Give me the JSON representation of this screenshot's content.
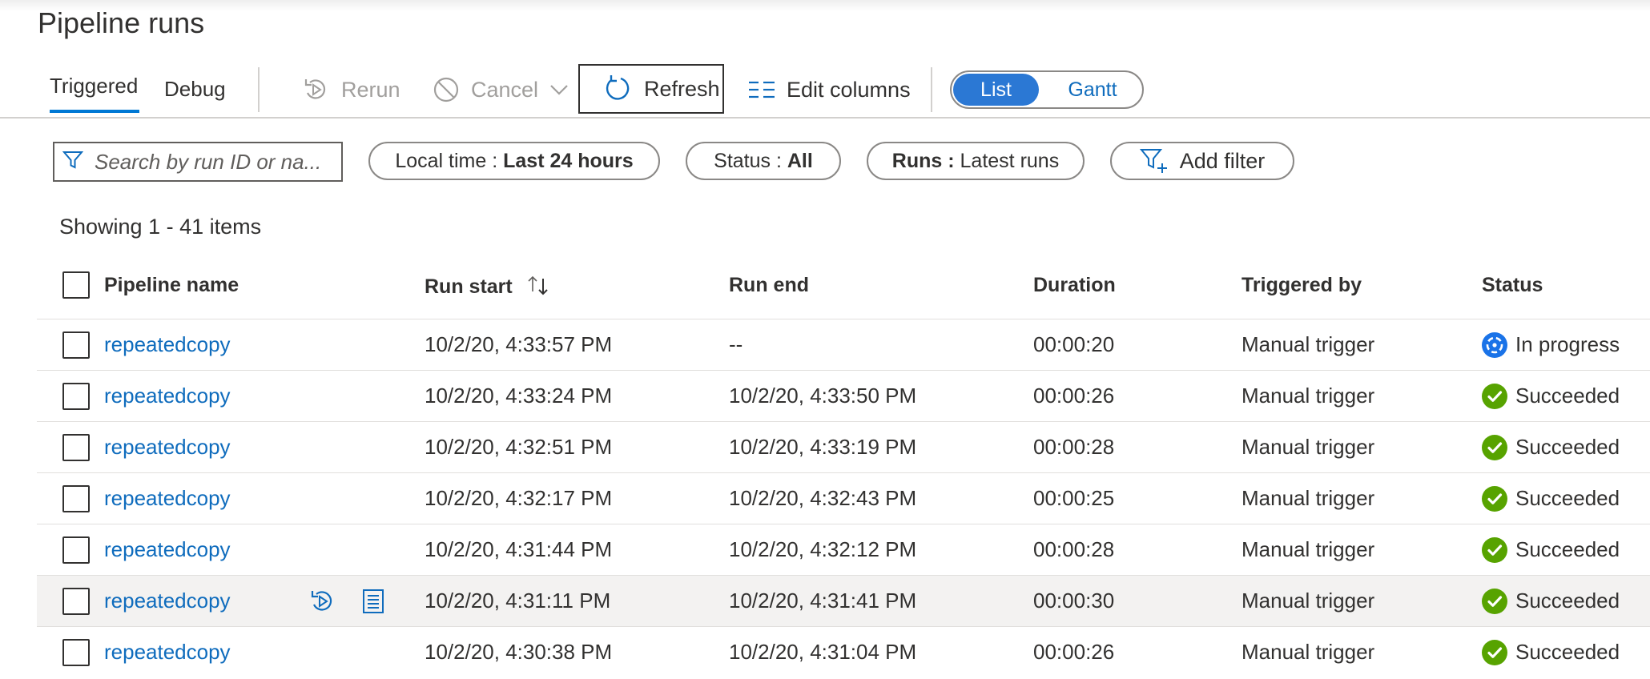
{
  "page": {
    "title": "Pipeline runs"
  },
  "tabs": [
    {
      "label": "Triggered",
      "active": true
    },
    {
      "label": "Debug",
      "active": false
    }
  ],
  "commands": {
    "rerun": "Rerun",
    "cancel": "Cancel",
    "refresh": "Refresh",
    "edit_columns": "Edit columns"
  },
  "view_toggle": {
    "list": "List",
    "gantt": "Gantt",
    "selected": "List"
  },
  "filters": {
    "search_placeholder": "Search by run ID or na...",
    "local_time_label": "Local time : ",
    "local_time_value": "Last 24 hours",
    "status_label": "Status : ",
    "status_value": "All",
    "runs_label": "Runs : ",
    "runs_value": "Latest runs",
    "add_filter": "Add filter"
  },
  "summary": {
    "showing": "Showing 1 - 41 items"
  },
  "table": {
    "columns": {
      "pipeline_name": "Pipeline name",
      "run_start": "Run start",
      "run_end": "Run end",
      "duration": "Duration",
      "triggered_by": "Triggered by",
      "status": "Status"
    },
    "rows": [
      {
        "pipeline": "repeatedcopy",
        "start": "10/2/20, 4:33:57 PM",
        "end": "--",
        "duration": "00:00:20",
        "trigger": "Manual trigger",
        "status": "In progress"
      },
      {
        "pipeline": "repeatedcopy",
        "start": "10/2/20, 4:33:24 PM",
        "end": "10/2/20, 4:33:50 PM",
        "duration": "00:00:26",
        "trigger": "Manual trigger",
        "status": "Succeeded"
      },
      {
        "pipeline": "repeatedcopy",
        "start": "10/2/20, 4:32:51 PM",
        "end": "10/2/20, 4:33:19 PM",
        "duration": "00:00:28",
        "trigger": "Manual trigger",
        "status": "Succeeded"
      },
      {
        "pipeline": "repeatedcopy",
        "start": "10/2/20, 4:32:17 PM",
        "end": "10/2/20, 4:32:43 PM",
        "duration": "00:00:25",
        "trigger": "Manual trigger",
        "status": "Succeeded"
      },
      {
        "pipeline": "repeatedcopy",
        "start": "10/2/20, 4:31:44 PM",
        "end": "10/2/20, 4:32:12 PM",
        "duration": "00:00:28",
        "trigger": "Manual trigger",
        "status": "Succeeded"
      },
      {
        "pipeline": "repeatedcopy",
        "start": "10/2/20, 4:31:11 PM",
        "end": "10/2/20, 4:31:41 PM",
        "duration": "00:00:30",
        "trigger": "Manual trigger",
        "status": "Succeeded"
      },
      {
        "pipeline": "repeatedcopy",
        "start": "10/2/20, 4:30:38 PM",
        "end": "10/2/20, 4:31:04 PM",
        "duration": "00:00:26",
        "trigger": "Manual trigger",
        "status": "Succeeded"
      }
    ]
  },
  "colors": {
    "accent": "#0078d4",
    "link": "#0f6cbd",
    "success": "#57a300",
    "in_progress": "#1a73e8",
    "hover_row": "#f3f2f1"
  },
  "icons": {
    "rerun": "rerun-icon",
    "cancel": "cancel-icon",
    "refresh": "refresh-icon",
    "edit_columns": "columns-icon",
    "search": "filter-icon",
    "add_filter": "add-filter-icon",
    "sort": "sort-icon",
    "succeeded": "checkmark-circle-icon",
    "in_progress": "in-progress-icon",
    "row_rerun": "rerun-icon",
    "row_consumption": "consumption-icon"
  }
}
